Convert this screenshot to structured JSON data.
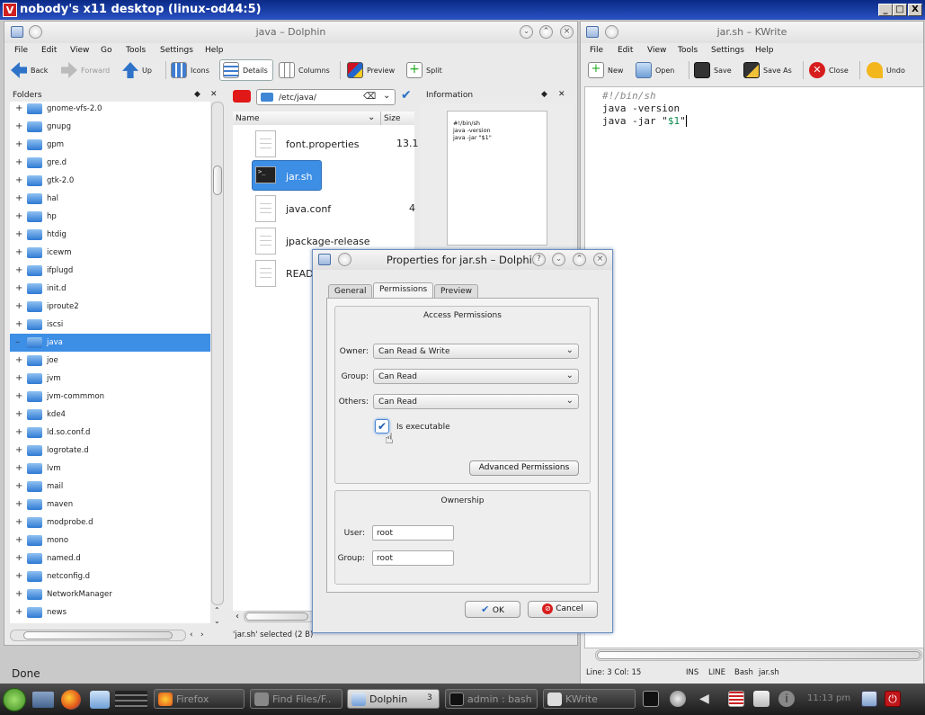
{
  "desktop_title": "nobody's x11 desktop (linux-od44:5)",
  "desktop_controls": {
    "minimize": "_",
    "maximize": "□",
    "close": "X"
  },
  "dolphin": {
    "title": "java – Dolphin",
    "menu": [
      "File",
      "Edit",
      "View",
      "Go",
      "Tools",
      "Settings",
      "Help"
    ],
    "toolbar": {
      "back": "Back",
      "forward": "Forward",
      "up": "Up",
      "icons": "Icons",
      "details": "Details",
      "columns": "Columns",
      "preview": "Preview",
      "split": "Split"
    },
    "folders_title": "Folders",
    "folders": [
      "gnome-vfs-2.0",
      "gnupg",
      "gpm",
      "gre.d",
      "gtk-2.0",
      "hal",
      "hp",
      "htdig",
      "icewm",
      "ifplugd",
      "init.d",
      "iproute2",
      "iscsi",
      "java",
      "joe",
      "jvm",
      "jvm-commmon",
      "kde4",
      "ld.so.conf.d",
      "logrotate.d",
      "lvm",
      "mail",
      "maven",
      "modprobe.d",
      "mono",
      "named.d",
      "netconfig.d",
      "NetworkManager",
      "news"
    ],
    "selected_folder": "java",
    "path": "/etc/java/",
    "columns": {
      "name": "Name",
      "size": "Size"
    },
    "files": [
      {
        "name": "font.properties",
        "size": "13.1"
      },
      {
        "name": "jar.sh",
        "size": ""
      },
      {
        "name": "java.conf",
        "size": "4"
      },
      {
        "name": "jpackage-release",
        "size": ""
      },
      {
        "name": "READ",
        "size": ""
      }
    ],
    "information_title": "Information",
    "preview_lines": [
      "#!/bin/sh",
      "java -version",
      "java -jar \"$1\""
    ],
    "statusbar": "'jar.sh' selected (2 B)"
  },
  "kwrite": {
    "title": "jar.sh – KWrite",
    "menu": [
      "File",
      "Edit",
      "View",
      "Tools",
      "Settings",
      "Help"
    ],
    "toolbar": {
      "new": "New",
      "open": "Open",
      "save": "Save",
      "save_as": "Save As",
      "close": "Close",
      "undo": "Undo"
    },
    "code": {
      "line1": "#!/bin/sh",
      "line2": "java -version",
      "line3_pre": "java -jar \"",
      "line3_var": "$1",
      "line3_post": "\""
    },
    "status": {
      "pos": "Line: 3 Col: 15",
      "ins": "INS",
      "mode": "LINE",
      "syntax": "Bash",
      "file": "jar.sh"
    }
  },
  "dialog": {
    "title": "Properties for jar.sh – Dolphin",
    "tabs": [
      "General",
      "Permissions",
      "Preview"
    ],
    "access_title": "Access Permissions",
    "owner_label": "Owner:",
    "owner_value": "Can Read & Write",
    "group_label": "Group:",
    "group_value": "Can Read",
    "others_label": "Others:",
    "others_value": "Can Read",
    "executable_label": "Is executable",
    "advanced_button": "Advanced Permissions",
    "ownership_title": "Ownership",
    "user_label": "User:",
    "user_value": "root",
    "groupown_label": "Group:",
    "groupown_value": "root",
    "ok": "OK",
    "cancel": "Cancel"
  },
  "done": "Done",
  "taskbar": {
    "items": [
      "Firefox",
      "Find Files/F..",
      "Dolphin",
      "admin : bash",
      "KWrite"
    ],
    "dolphin_count": "3",
    "clock": "11:13 pm"
  }
}
